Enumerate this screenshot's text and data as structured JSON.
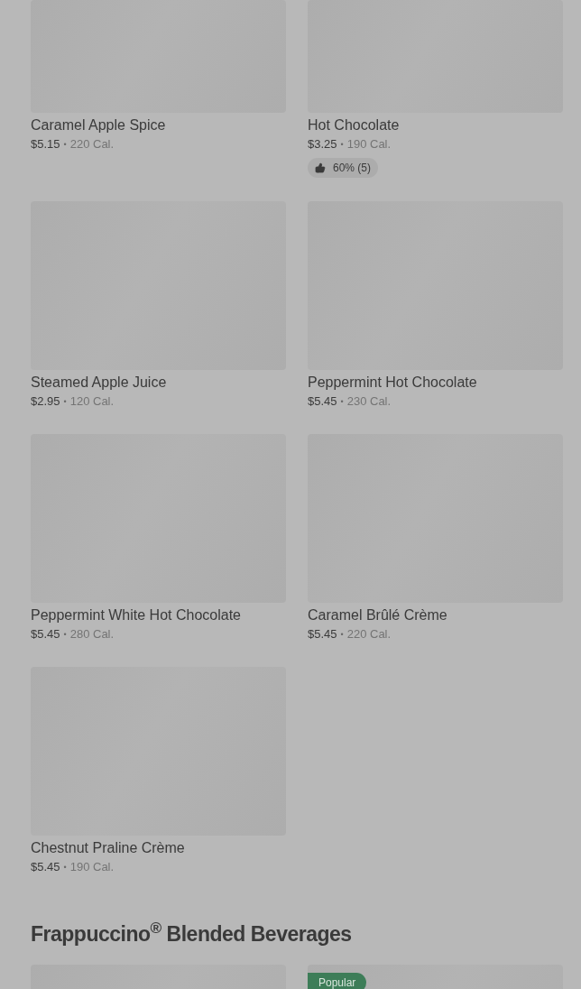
{
  "items": [
    {
      "name": "Caramel Apple Spice",
      "price": "$5.15",
      "separator": "•",
      "calories": "220 Cal."
    },
    {
      "name": "Hot Chocolate",
      "price": "$3.25",
      "separator": "•",
      "calories": "190 Cal.",
      "rating": "60% (5)"
    },
    {
      "name": "Steamed Apple Juice",
      "price": "$2.95",
      "separator": "•",
      "calories": "120 Cal."
    },
    {
      "name": "Peppermint Hot Chocolate",
      "price": "$5.45",
      "separator": "•",
      "calories": "230 Cal."
    },
    {
      "name": "Peppermint White Hot Chocolate",
      "price": "$5.45",
      "separator": "•",
      "calories": "280 Cal."
    },
    {
      "name": "Caramel Brûlé Crème",
      "price": "$5.45",
      "separator": "•",
      "calories": "220 Cal."
    },
    {
      "name": "Chestnut Praline Crème",
      "price": "$5.45",
      "separator": "•",
      "calories": "190 Cal."
    }
  ],
  "next_section": {
    "title": "Frappuccino$^{®}$ Blended Beverages",
    "items": [
      {
        "kind": "picture"
      },
      {
        "kind": "picture",
        "badge": "Popular"
      }
    ]
  }
}
